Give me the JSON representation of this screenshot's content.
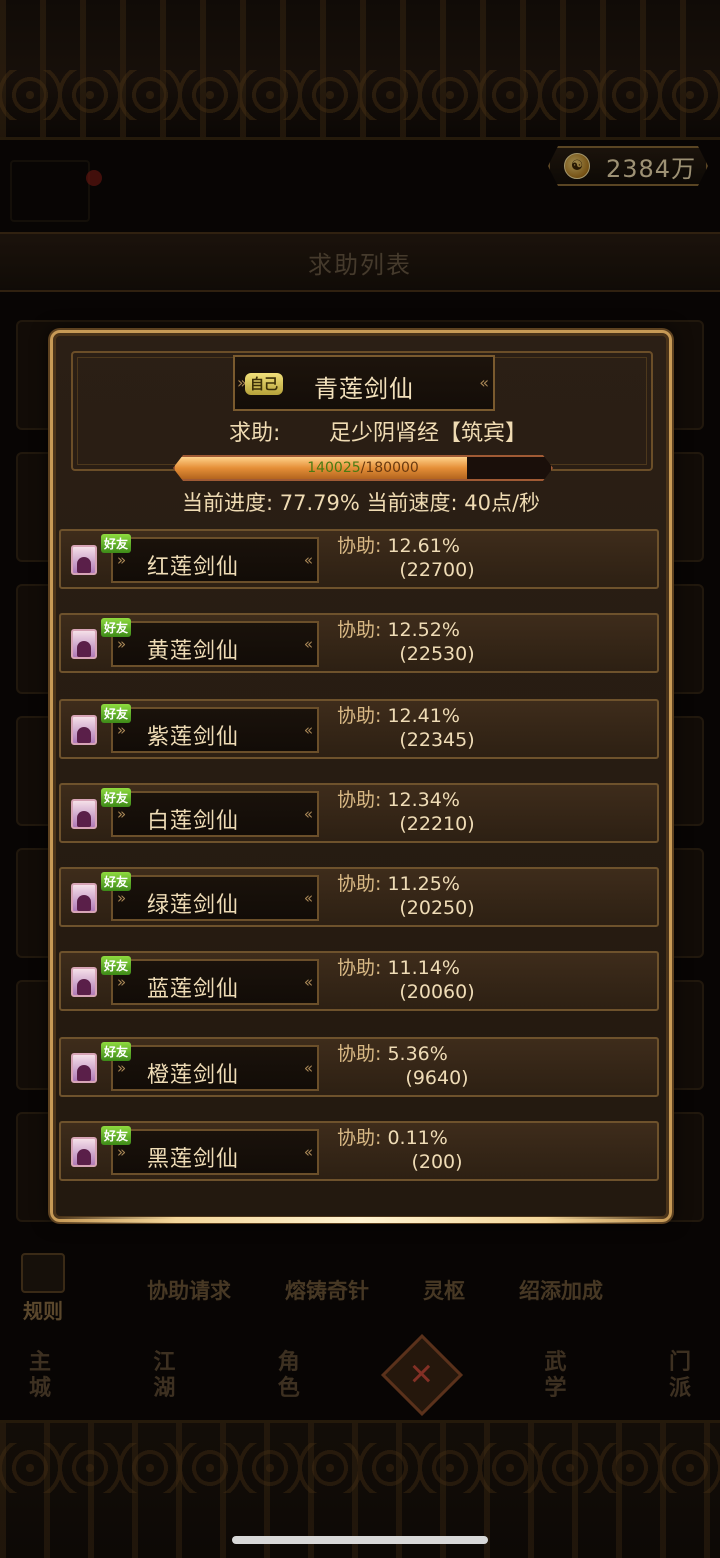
{
  "currency": {
    "icon": "yin-yang-coin-icon",
    "value": "2384万"
  },
  "background": {
    "header_title": "求助列表",
    "bottom_tabs": [
      "协助请求",
      "熔铸奇针",
      "灵枢",
      "绍添加成"
    ],
    "rules_label": "规则",
    "nav_items": [
      "主城",
      "江湖",
      "角色",
      "武学",
      "门派"
    ]
  },
  "dialog": {
    "self_badge": "自己",
    "requester_name": "青莲剑仙",
    "help_label": "求助:",
    "help_target": "足少阴肾经【筑宾】",
    "progress": {
      "current": "140025",
      "max": "180000",
      "fraction": 0.7779
    },
    "progress_info": "当前进度: 77.79%  当前速度: 40点/秒"
  },
  "helpers": [
    {
      "badge": "好友",
      "name": "红莲剑仙",
      "assist_label": "协助:",
      "percent": "12.61%",
      "amount": "(22700)"
    },
    {
      "badge": "好友",
      "name": "黄莲剑仙",
      "assist_label": "协助:",
      "percent": "12.52%",
      "amount": "(22530)"
    },
    {
      "badge": "好友",
      "name": "紫莲剑仙",
      "assist_label": "协助:",
      "percent": "12.41%",
      "amount": "(22345)"
    },
    {
      "badge": "好友",
      "name": "白莲剑仙",
      "assist_label": "协助:",
      "percent": "12.34%",
      "amount": "(22210)"
    },
    {
      "badge": "好友",
      "name": "绿莲剑仙",
      "assist_label": "协助:",
      "percent": "11.25%",
      "amount": "(20250)"
    },
    {
      "badge": "好友",
      "name": "蓝莲剑仙",
      "assist_label": "协助:",
      "percent": "11.14%",
      "amount": "(20060)"
    },
    {
      "badge": "好友",
      "name": "橙莲剑仙",
      "assist_label": "协助:",
      "percent": "5.36%",
      "amount": "(9640)"
    },
    {
      "badge": "好友",
      "name": "黑莲剑仙",
      "assist_label": "协助:",
      "percent": "0.11%",
      "amount": "(200)"
    }
  ]
}
